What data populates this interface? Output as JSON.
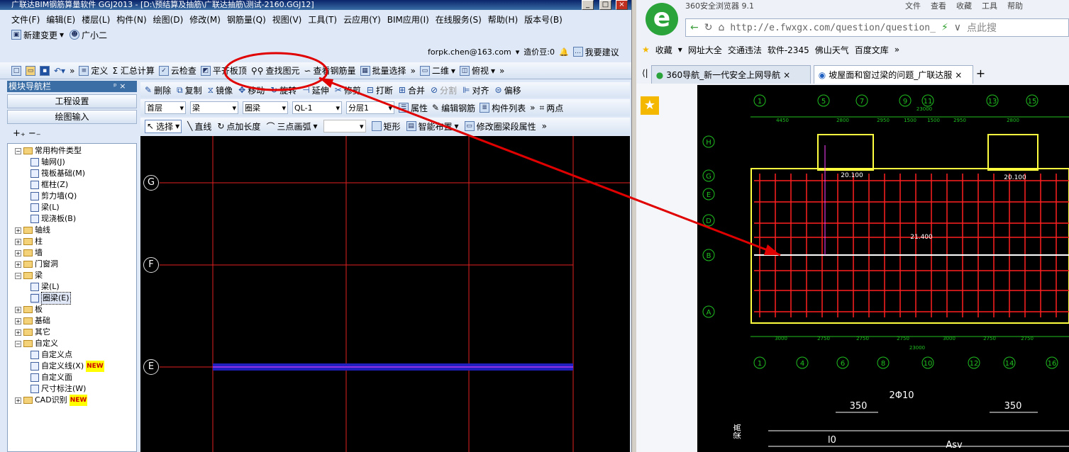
{
  "app": {
    "title": "广联达BIM钢筋算量软件 GGJ2013 - [D:\\预结算及抽筋\\广联达抽筋\\测试-2160.GGJ12]",
    "window_buttons": [
      "_",
      "□",
      "×"
    ],
    "menu": [
      "文件(F)",
      "编辑(E)",
      "楼层(L)",
      "构件(N)",
      "绘图(D)",
      "修改(M)",
      "钢筋量(Q)",
      "视图(V)",
      "工具(T)",
      "云应用(Y)",
      "BIM应用(I)",
      "在线服务(S)",
      "帮助(H)",
      "版本号(B)"
    ],
    "row2": {
      "new_change": "新建变更",
      "helper": "广小二"
    },
    "user": {
      "email": "forpk.chen@163.com",
      "price_beans": "造价豆:0",
      "suggest": "我要建议"
    },
    "toolbar1": [
      "定义",
      "Σ 汇总计算",
      "云检查",
      "平齐板顶",
      "查找图元",
      "查看钢筋量",
      "批量选择",
      "二维",
      "俯视"
    ],
    "nav": {
      "header": "模块导航栏",
      "pin": "ᵖ ×",
      "btn1": "工程设置",
      "btn2": "绘图输入",
      "tools": "+₊ −₋"
    },
    "tree": [
      {
        "label": "常用构件类型",
        "level": 0,
        "exp": "−",
        "type": "folder"
      },
      {
        "label": "轴网(J)",
        "level": 2,
        "type": "item"
      },
      {
        "label": "筏板基础(M)",
        "level": 2,
        "type": "item"
      },
      {
        "label": "框柱(Z)",
        "level": 2,
        "type": "item"
      },
      {
        "label": "剪力墙(Q)",
        "level": 2,
        "type": "item"
      },
      {
        "label": "梁(L)",
        "level": 2,
        "type": "item"
      },
      {
        "label": "现浇板(B)",
        "level": 2,
        "type": "item"
      },
      {
        "label": "轴线",
        "level": 0,
        "exp": "+",
        "type": "folder"
      },
      {
        "label": "柱",
        "level": 0,
        "exp": "+",
        "type": "folder"
      },
      {
        "label": "墙",
        "level": 0,
        "exp": "+",
        "type": "folder"
      },
      {
        "label": "门窗洞",
        "level": 0,
        "exp": "+",
        "type": "folder"
      },
      {
        "label": "梁",
        "level": 0,
        "exp": "−",
        "type": "folder"
      },
      {
        "label": "梁(L)",
        "level": 2,
        "type": "item"
      },
      {
        "label": "圈梁(E)",
        "level": 2,
        "type": "item",
        "selected": true
      },
      {
        "label": "板",
        "level": 0,
        "exp": "+",
        "type": "folder"
      },
      {
        "label": "基础",
        "level": 0,
        "exp": "+",
        "type": "folder"
      },
      {
        "label": "其它",
        "level": 0,
        "exp": "+",
        "type": "folder"
      },
      {
        "label": "自定义",
        "level": 0,
        "exp": "−",
        "type": "folder"
      },
      {
        "label": "自定义点",
        "level": 2,
        "type": "item"
      },
      {
        "label": "自定义线(X)",
        "level": 2,
        "type": "item",
        "new": true
      },
      {
        "label": "自定义面",
        "level": 2,
        "type": "item"
      },
      {
        "label": "尺寸标注(W)",
        "level": 2,
        "type": "item"
      },
      {
        "label": "CAD识别",
        "level": 0,
        "exp": "+",
        "type": "folder",
        "new": true
      }
    ],
    "new_badge": "NEW",
    "toolbar2": [
      "删除",
      "复制",
      "镜像",
      "移动",
      "旋转",
      "延伸",
      "修剪",
      "打断",
      "合并",
      "分割",
      "对齐",
      "偏移"
    ],
    "toolbar3": {
      "floor": "首层",
      "type": "梁",
      "subtype": "圈梁",
      "name": "QL-1",
      "layer": "分层1",
      "items": [
        "属性",
        "编辑钢筋",
        "构件列表",
        "两点"
      ]
    },
    "toolbar4": [
      "选择",
      "直线",
      "点加长度",
      "三点画弧",
      "矩形",
      "智能布置",
      "修改圈梁段属性"
    ],
    "canvas_axes": [
      "G",
      "F",
      "E"
    ]
  },
  "browser": {
    "title": "360安全浏览器 9.1",
    "title_menu": [
      "文件",
      "查看",
      "收藏",
      "工具",
      "帮助"
    ],
    "url": "http://e.fwxgx.com/question/question_",
    "search_hint": "点此搜",
    "favorites": [
      "收藏",
      "网址大全",
      "交通违法",
      "软件-2345",
      "佛山天气",
      "百度文库"
    ],
    "tabs": [
      "360导航_新一代安全上网导航",
      "坡屋面和窗过梁的问题_广联达服"
    ],
    "add_tab": "+",
    "cad_axes_top": [
      "1",
      "5",
      "7",
      "9",
      "11",
      "13",
      "15"
    ],
    "cad_axes_bottom": [
      "1",
      "4",
      "6",
      "8",
      "10",
      "12",
      "14",
      "16"
    ],
    "cad_axes_left": [
      "H",
      "G",
      "E",
      "D",
      "B",
      "A"
    ],
    "cad_dims_top": [
      "4450",
      "2800",
      "2950",
      "1500",
      "1500",
      "2950",
      "2800"
    ],
    "cad_dim_total_top": "23000",
    "cad_dims_bottom": [
      "3000",
      "2750",
      "2750",
      "2750",
      "3000",
      "2750",
      "2750"
    ],
    "cad_dim_total_bottom": "23000",
    "cad_elev": [
      "20.100",
      "20.100",
      "21.400"
    ],
    "cad_detail": {
      "dim1": "350",
      "dim2": "350",
      "rebar": "2Φ10",
      "label_left": "梁高",
      "asv": "Asv",
      "lo": "l0"
    }
  },
  "colors": {
    "arrow": "#e00000",
    "axis": "#ff2020",
    "beam": "#3030ff",
    "cad_green": "#20c020"
  }
}
